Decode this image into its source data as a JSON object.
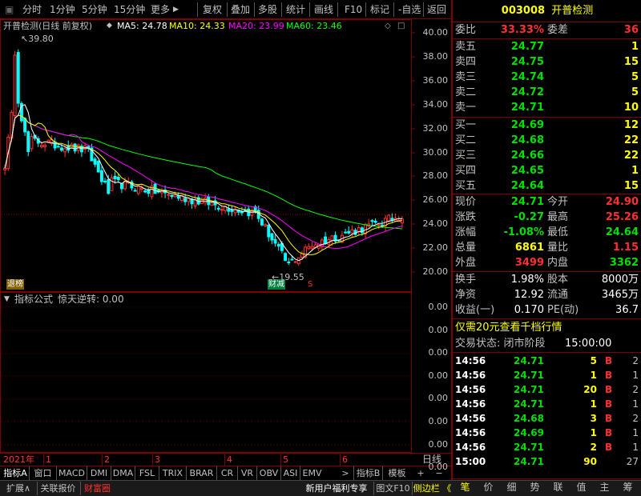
{
  "toolbar": {
    "items": [
      "分时",
      "1分钟",
      "5分钟",
      "15分钟",
      "更多",
      "复权",
      "叠加",
      "多股",
      "统计",
      "画线",
      "F10",
      "标记",
      "-自选",
      "返回"
    ]
  },
  "chart_header": {
    "stock_name": "开普检测",
    "mode": "(日线 前复权)",
    "ma5": "MA5: 24.78",
    "ma10": "MA10: 24.33",
    "ma20": "MA20: 23.99",
    "ma60": "MA60: 23.46",
    "high_mark": "39.80",
    "low_mark": "19.55",
    "badge_left": "退榜",
    "badge_mid": "财减",
    "badge_s": "S"
  },
  "indicator_header": {
    "label": "指标公式",
    "name": "惊天逆转: 0.00"
  },
  "price_axis": [
    "40.00",
    "38.00",
    "36.00",
    "34.00",
    "32.00",
    "30.00",
    "28.00",
    "26.00",
    "24.00",
    "22.00",
    "20.00"
  ],
  "indicator_axis": [
    "0.00",
    "0.00",
    "0.00",
    "0.00",
    "0.00",
    "0.00",
    "0.00",
    "0.00",
    "0.00",
    "0.00"
  ],
  "time_axis": {
    "year": "2021年",
    "months": [
      "1",
      "2",
      "3",
      "4",
      "5",
      "6"
    ],
    "period_label": "日线"
  },
  "indicator_tabs": [
    "指标A",
    "窗口",
    "MACD",
    "DMI",
    "DMA",
    "FSL",
    "TRIX",
    "BRAR",
    "CR",
    "VR",
    "OBV",
    "ASI",
    "EMV"
  ],
  "indicator_tabs_right": [
    "指标B",
    "模板"
  ],
  "status_bar": {
    "left": [
      "扩展∧",
      "关联报价",
      "财富圈"
    ],
    "right": [
      "新用户福利专享",
      "图文F10",
      "侧边栏 《"
    ]
  },
  "quote": {
    "code": "003008",
    "name": "开普检测",
    "weibi_label": "委比",
    "weibi": "33.33%",
    "weicha_label": "委差",
    "weicha": "36",
    "asks": [
      {
        "label": "卖五",
        "price": "24.77",
        "vol": "1"
      },
      {
        "label": "卖四",
        "price": "24.75",
        "vol": "15"
      },
      {
        "label": "卖三",
        "price": "24.74",
        "vol": "5"
      },
      {
        "label": "卖二",
        "price": "24.72",
        "vol": "5"
      },
      {
        "label": "卖一",
        "price": "24.71",
        "vol": "10"
      }
    ],
    "bids": [
      {
        "label": "买一",
        "price": "24.69",
        "vol": "12"
      },
      {
        "label": "买二",
        "price": "24.68",
        "vol": "22"
      },
      {
        "label": "买三",
        "price": "24.66",
        "vol": "22"
      },
      {
        "label": "买四",
        "price": "24.65",
        "vol": "1"
      },
      {
        "label": "买五",
        "price": "24.64",
        "vol": "15"
      }
    ],
    "stats": [
      {
        "l1": "现价",
        "v1": "24.71",
        "c1": "#00e000",
        "l2": "今开",
        "v2": "24.90",
        "c2": "#ff3030"
      },
      {
        "l1": "涨跌",
        "v1": "-0.27",
        "c1": "#00e000",
        "l2": "最高",
        "v2": "25.26",
        "c2": "#ff3030"
      },
      {
        "l1": "涨幅",
        "v1": "-1.08%",
        "c1": "#00e000",
        "l2": "最低",
        "v2": "24.64",
        "c2": "#00e000"
      },
      {
        "l1": "总量",
        "v1": "6861",
        "c1": "#ffff00",
        "l2": "量比",
        "v2": "1.15",
        "c2": "#ff3030"
      },
      {
        "l1": "外盘",
        "v1": "3499",
        "c1": "#ff3030",
        "l2": "内盘",
        "v2": "3362",
        "c2": "#00e000"
      }
    ],
    "fund": [
      {
        "l1": "换手",
        "v1": "1.98%",
        "l2": "股本",
        "v2": "8000万"
      },
      {
        "l1": "净资",
        "v1": "12.92",
        "l2": "流通",
        "v2": "3465万"
      },
      {
        "l1": "收益(一)",
        "v1": "0.170",
        "l2": "PE(动)",
        "v2": "36.7"
      }
    ],
    "promo": "仅需20元查看千档行情",
    "trade_status_label": "交易状态: 闭市阶段",
    "trade_status_time": "15:00:00"
  },
  "ticks": [
    {
      "time": "14:56",
      "price": "24.71",
      "vol": "5",
      "bs": "B",
      "n": "2"
    },
    {
      "time": "14:56",
      "price": "24.71",
      "vol": "1",
      "bs": "B",
      "n": "1"
    },
    {
      "time": "14:56",
      "price": "24.71",
      "vol": "20",
      "bs": "B",
      "n": "2"
    },
    {
      "time": "14:56",
      "price": "24.71",
      "vol": "1",
      "bs": "B",
      "n": "1"
    },
    {
      "time": "14:56",
      "price": "24.68",
      "vol": "3",
      "bs": "B",
      "n": "2"
    },
    {
      "time": "14:56",
      "price": "24.69",
      "vol": "1",
      "bs": "B",
      "n": "1"
    },
    {
      "time": "14:56",
      "price": "24.71",
      "vol": "2",
      "bs": "B",
      "n": "1"
    },
    {
      "time": "15:00",
      "price": "24.71",
      "vol": "90",
      "bs": "",
      "n": "27"
    }
  ],
  "side_tabs": [
    "笔",
    "价",
    "细",
    "势",
    "联",
    "值",
    "主",
    "筹"
  ],
  "colors": {
    "up": "#ff3030",
    "down": "#00e000",
    "frame": "#800000",
    "ma5": "#ffffff",
    "ma10": "#ffff00",
    "ma20": "#ff00ff",
    "ma60": "#00ff00",
    "label": "#c0c0c0"
  }
}
